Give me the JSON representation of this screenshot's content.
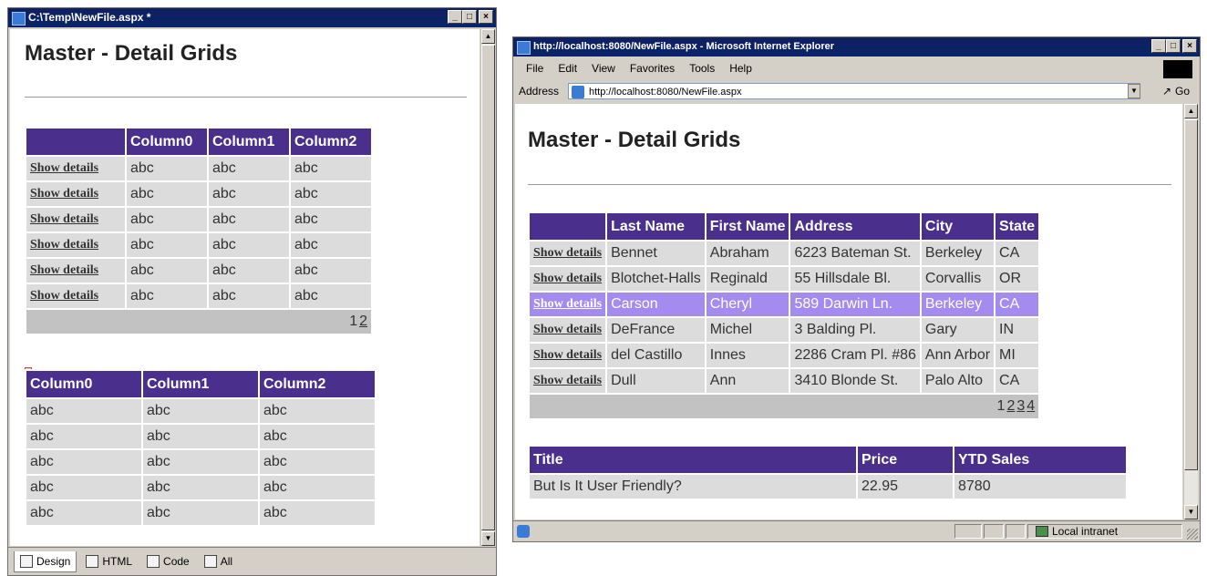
{
  "designer": {
    "title": "C:\\Temp\\NewFile.aspx *",
    "heading": "Master - Detail Grids",
    "master": {
      "headers": [
        "",
        "Column0",
        "Column1",
        "Column2"
      ],
      "rows": [
        [
          "Show details",
          "abc",
          "abc",
          "abc"
        ],
        [
          "Show details",
          "abc",
          "abc",
          "abc"
        ],
        [
          "Show details",
          "abc",
          "abc",
          "abc"
        ],
        [
          "Show details",
          "abc",
          "abc",
          "abc"
        ],
        [
          "Show details",
          "abc",
          "abc",
          "abc"
        ],
        [
          "Show details",
          "abc",
          "abc",
          "abc"
        ]
      ],
      "pager": [
        "1",
        "2"
      ]
    },
    "detail": {
      "headers": [
        "Column0",
        "Column1",
        "Column2"
      ],
      "rows": [
        [
          "abc",
          "abc",
          "abc"
        ],
        [
          "abc",
          "abc",
          "abc"
        ],
        [
          "abc",
          "abc",
          "abc"
        ],
        [
          "abc",
          "abc",
          "abc"
        ],
        [
          "abc",
          "abc",
          "abc"
        ]
      ]
    },
    "tabs": [
      "Design",
      "HTML",
      "Code",
      "All"
    ]
  },
  "browser": {
    "title": "http://localhost:8080/NewFile.aspx - Microsoft Internet Explorer",
    "menu": [
      "File",
      "Edit",
      "View",
      "Favorites",
      "Tools",
      "Help"
    ],
    "address_label": "Address",
    "address_url": "http://localhost:8080/NewFile.aspx",
    "go_label": "Go",
    "heading": "Master - Detail Grids",
    "master": {
      "headers": [
        "",
        "Last Name",
        "First Name",
        "Address",
        "City",
        "State"
      ],
      "rows": [
        [
          "Show details",
          "Bennet",
          "Abraham",
          "6223 Bateman St.",
          "Berkeley",
          "CA"
        ],
        [
          "Show details",
          "Blotchet-Halls",
          "Reginald",
          "55 Hillsdale Bl.",
          "Corvallis",
          "OR"
        ],
        [
          "Show details",
          "Carson",
          "Cheryl",
          "589 Darwin Ln.",
          "Berkeley",
          "CA"
        ],
        [
          "Show details",
          "DeFrance",
          "Michel",
          "3 Balding Pl.",
          "Gary",
          "IN"
        ],
        [
          "Show details",
          "del Castillo",
          "Innes",
          "2286 Cram Pl. #86",
          "Ann Arbor",
          "MI"
        ],
        [
          "Show details",
          "Dull",
          "Ann",
          "3410 Blonde St.",
          "Palo Alto",
          "CA"
        ]
      ],
      "selected_row": 2,
      "pager": [
        "1",
        "2",
        "3",
        "4"
      ]
    },
    "detail": {
      "headers": [
        "Title",
        "Price",
        "YTD Sales"
      ],
      "rows": [
        [
          "But Is It User Friendly?",
          "22.95",
          "8780"
        ]
      ]
    },
    "status_zone": "Local intranet"
  },
  "colors": {
    "header_bg": "#4b2f8c",
    "row_bg": "#dcdcdc",
    "selected_bg": "#a48bf0",
    "pager_bg": "#c2c2c2",
    "titlebar": "#0a246a"
  }
}
